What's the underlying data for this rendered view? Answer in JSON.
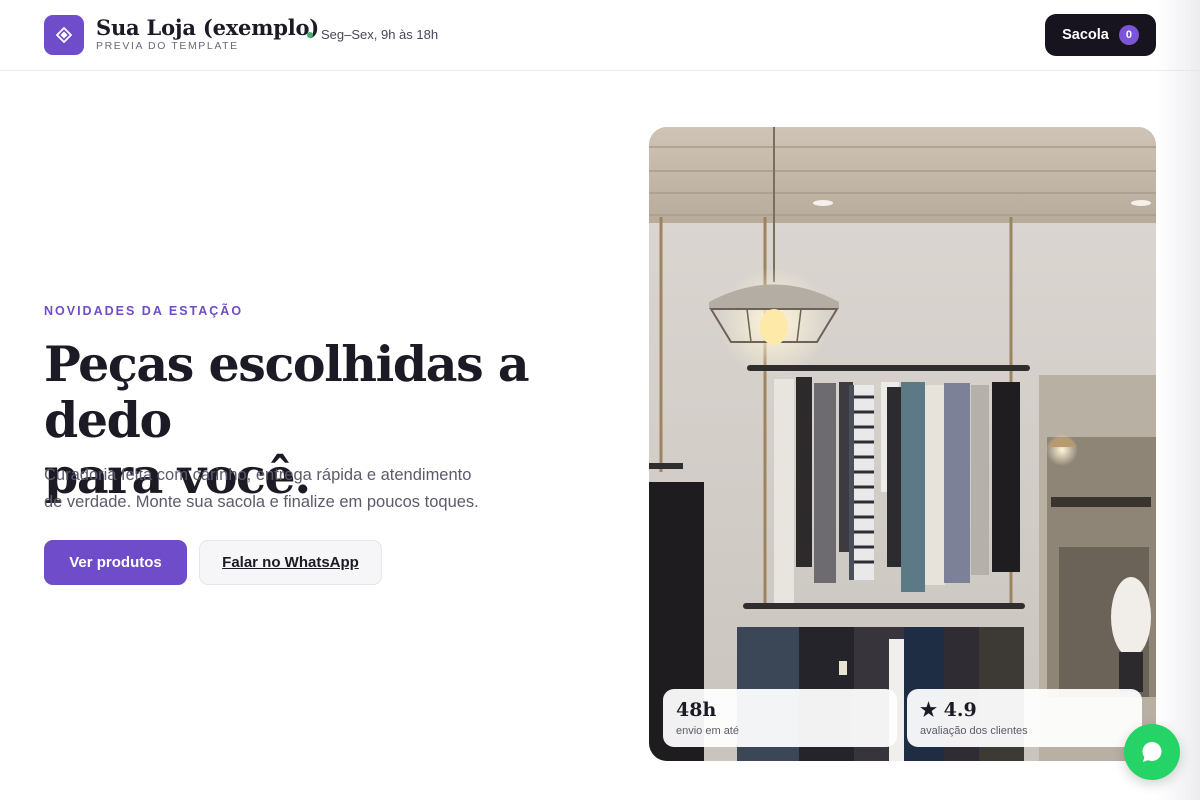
{
  "header": {
    "brand_name": "Sua Loja (exemplo)",
    "brand_subtitle": "PREVIA DO TEMPLATE",
    "hours": "Seg–Sex, 9h às 18h",
    "bag_label": "Sacola",
    "bag_count": "0",
    "logo_icon": "diamond-icon"
  },
  "hero": {
    "eyebrow": "NOVIDADES DA ESTAÇÃO",
    "headline_line1": "Peças escolhidas a dedo",
    "headline_line2": "para você.",
    "subtext_line1": "Curadoria feita com carinho, entrega rápida e atendimento",
    "subtext_line2": "de verdade. Monte sua sacola e finalize em poucos toques.",
    "primary_button": "Ver produtos",
    "secondary_button": "Falar no WhatsApp",
    "image_icon": "clothing-store-photo"
  },
  "stats": [
    {
      "value": "48h",
      "label": "envio em até"
    },
    {
      "value": "★ 4.9",
      "label": "avaliação dos clientes"
    }
  ],
  "floating": {
    "icon": "whatsapp-chat-icon"
  },
  "colors": {
    "accent": "#6f4cc9",
    "dark": "#17141f",
    "status_green": "#3fb16a",
    "whatsapp": "#25d366"
  }
}
